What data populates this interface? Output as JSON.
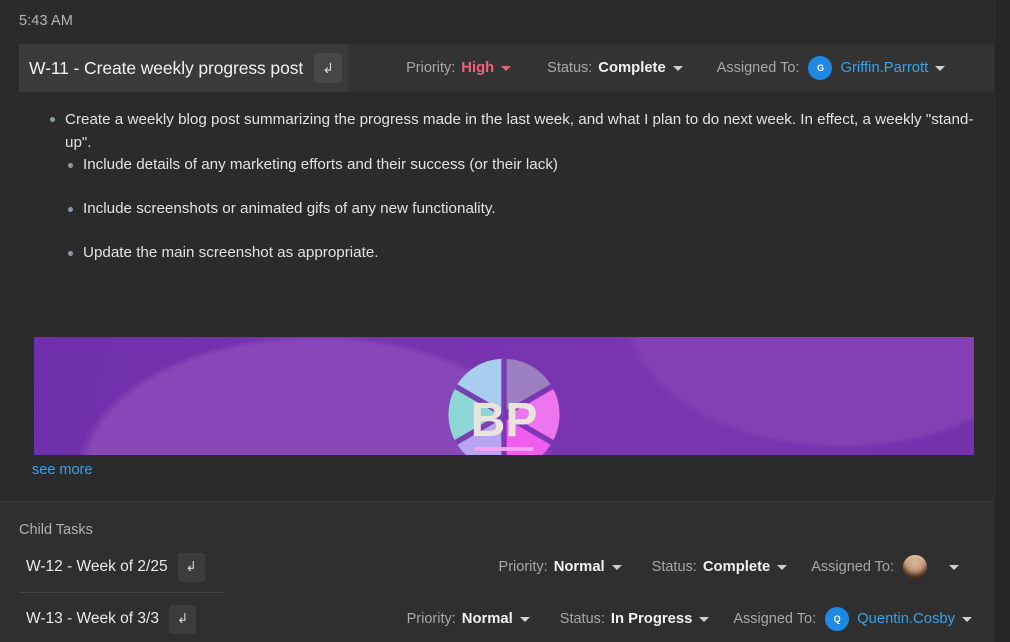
{
  "timestamp": "5:43 AM",
  "main_task": {
    "title": "W-11 - Create weekly progress post",
    "jump_icon": "arrow-down-right-icon",
    "priority": {
      "label": "Priority:",
      "value": "High",
      "color": "#f4607c"
    },
    "status": {
      "label": "Status:",
      "value": "Complete"
    },
    "assigned": {
      "label": "Assigned To:",
      "name": "Griffin.Parrott",
      "avatar_initial": "G",
      "avatar_color": "#1e88e5"
    }
  },
  "description": {
    "items": [
      "Create a weekly blog post summarizing the progress made in the last week, and what I plan to do next week. In effect, a weekly \"stand-up\".",
      "Include details of any marketing efforts and their success (or their lack)",
      "Include screenshots or animated gifs of any new functionality.",
      "Update the main screenshot as appropriate."
    ]
  },
  "banner": {
    "logo_text": "BP",
    "background_color": "#7331ae",
    "alt": "aperture-logo"
  },
  "see_more_label": "see more",
  "child_tasks": {
    "heading": "Child Tasks",
    "rows": [
      {
        "title": "W-12 - Week of 2/25",
        "jump_icon": "arrow-down-right-icon",
        "priority_label": "Priority:",
        "priority_value": "Normal",
        "status_label": "Status:",
        "status_value": "Complete",
        "assigned_label": "Assigned To:",
        "assignee_name": "",
        "avatar_initial": "",
        "avatar_type": "photo"
      },
      {
        "title": "W-13 - Week of 3/3",
        "jump_icon": "arrow-down-right-icon",
        "priority_label": "Priority:",
        "priority_value": "Normal",
        "status_label": "Status:",
        "status_value": "In Progress",
        "assigned_label": "Assigned To:",
        "assignee_name": "Quentin.Cosby",
        "avatar_initial": "Q",
        "avatar_type": "initial"
      }
    ]
  },
  "colors": {
    "page_bg": "#2b2b2b",
    "header_bg": "#333333",
    "link": "#36a2f0",
    "accent_pink": "#f4607c",
    "banner_purple": "#7331ae"
  }
}
